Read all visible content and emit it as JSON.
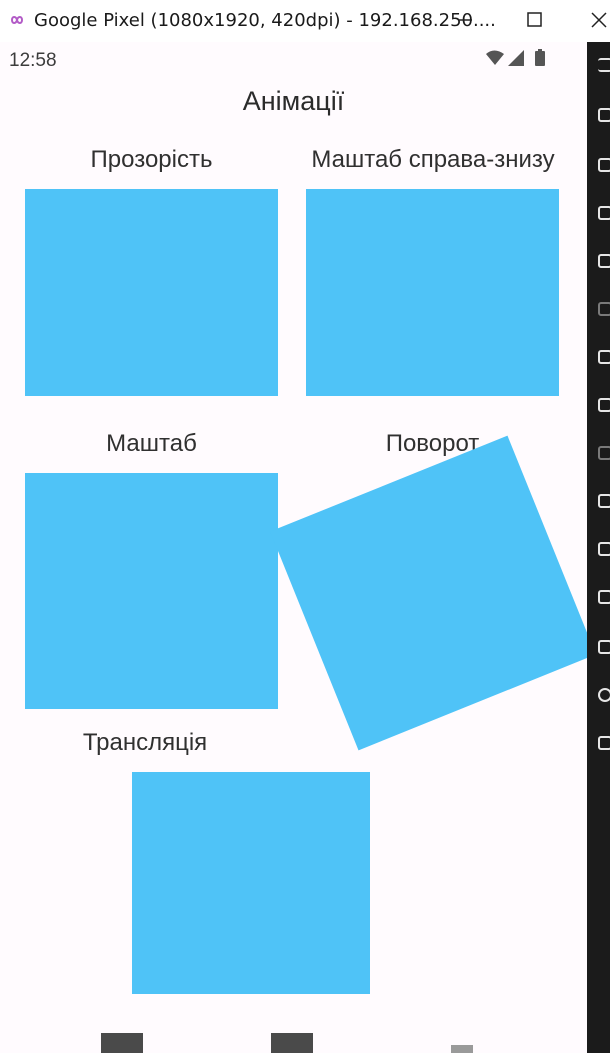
{
  "window": {
    "title": "Google Pixel (1080x1920, 420dpi) - 192.168.250....",
    "logo_icon": "infinity-icon",
    "minimize_icon": "minimize-icon",
    "maximize_icon": "maximize-icon",
    "close_icon": "close-icon"
  },
  "status_bar": {
    "time": "12:58",
    "icons": [
      "wifi-icon",
      "signal-icon",
      "battery-icon"
    ]
  },
  "app": {
    "title": "Анімації",
    "box_color": "#4fc3f7",
    "items": [
      {
        "label": "Прозорість"
      },
      {
        "label": "Маштаб справа-знизу"
      },
      {
        "label": "Маштаб"
      },
      {
        "label": "Поворот",
        "rotation_deg": -22
      },
      {
        "label": "Трансляція"
      }
    ]
  },
  "nav_bar": {
    "icons": [
      "back-icon",
      "home-icon",
      "recents-icon"
    ]
  },
  "emulator_sidebar": {
    "icons": [
      "menu-icon",
      "back-arrow-icon",
      "camera-icon",
      "screenshot-icon",
      "resize-icon",
      "sensors-icon",
      "gesture-icon",
      "google-icon",
      "film-icon",
      "fingerprint-icon",
      "code-icon",
      "google-icon",
      "back-icon",
      "power-icon",
      "rotate-icon"
    ]
  }
}
